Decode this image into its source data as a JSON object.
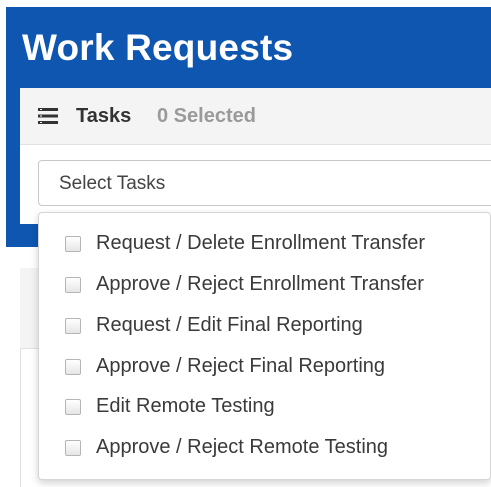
{
  "header": {
    "title": "Work Requests"
  },
  "tasks_card": {
    "label": "Tasks",
    "selected_count": "0 Selected",
    "icon": "list-icon",
    "select": {
      "value": "Select Tasks"
    }
  },
  "dropdown": {
    "options": [
      {
        "label": "Request / Delete Enrollment Transfer",
        "checked": false
      },
      {
        "label": "Approve / Reject Enrollment Transfer",
        "checked": false
      },
      {
        "label": "Request / Edit Final Reporting",
        "checked": false
      },
      {
        "label": "Approve / Reject Final Reporting",
        "checked": false
      },
      {
        "label": "Edit Remote Testing",
        "checked": false
      },
      {
        "label": "Approve / Reject Remote Testing",
        "checked": false
      }
    ]
  },
  "colors": {
    "header_blue": "#0e56b0"
  }
}
